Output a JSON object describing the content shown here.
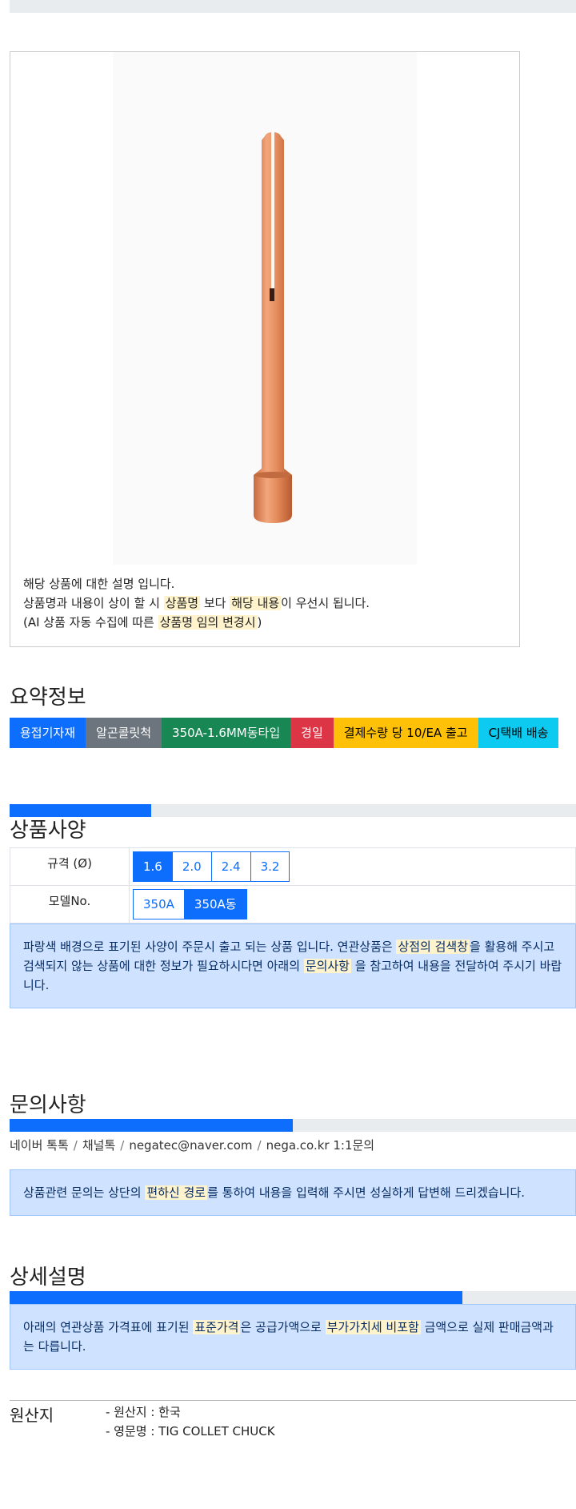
{
  "product": {
    "image_alt": "TIG collet chuck product image",
    "notes": {
      "line1": "해당 상품에 대한 설명 입니다.",
      "line2_a": "상품명과 내용이 상이 할 시 ",
      "line2_hl1": "상품명",
      "line2_b": " 보다 ",
      "line2_hl2": "해당 내용",
      "line2_c": "이 우선시 됩니다.",
      "line3_a": "(AI 상품 자동 수집에 따른 ",
      "line3_hl": "상품명 임의 변경시",
      "line3_b": ")"
    }
  },
  "summary": {
    "title": "요약정보",
    "tags": [
      {
        "label": "용접기자재",
        "color": "#0d6efd",
        "text_color": "#ffffff"
      },
      {
        "label": "알곤콜릿척",
        "color": "#6c757d",
        "text_color": "#ffffff"
      },
      {
        "label": "350A-1.6MM동타입",
        "color": "#198754",
        "text_color": "#ffffff"
      },
      {
        "label": "경일",
        "color": "#dc3545",
        "text_color": "#ffffff"
      },
      {
        "label": "결제수량 당 10/EA 출고",
        "color": "#ffc107",
        "text_color": "#000000"
      },
      {
        "label": "CJ택배 배송",
        "color": "#0dcaf0",
        "text_color": "#000000"
      }
    ]
  },
  "spec": {
    "title": "상품사양",
    "progress_fraction": 0.25,
    "rows": [
      {
        "label": "규격 (Ø)",
        "options": [
          "1.6",
          "2.0",
          "2.4",
          "3.2"
        ],
        "selected": 0
      },
      {
        "label": "모델No.",
        "options": [
          "350A",
          "350A동"
        ],
        "selected": 1
      }
    ],
    "notice": {
      "a": "파랑색 배경으로 표기된 사양이 주문시 출고 되는 상품 입니다. 연관상품은 ",
      "hl1": "상점의 검색창",
      "b": "을 활용해 주시고 검색되지 않는 상품에 대한 정보가 필요하시다면 아래의 ",
      "hl2": "문의사항",
      "c": " 을 참고하여 내용을 전달하여 주시기 바랍니다."
    }
  },
  "inquiry": {
    "title": "문의사항",
    "progress_fraction": 0.5,
    "contacts": [
      "네이버 톡톡",
      "채널톡",
      "negatec@naver.com",
      "nega.co.kr 1:1문의"
    ],
    "separator": "/",
    "notice": {
      "a": "상품관련 문의는 상단의 ",
      "hl": "편하신 경로",
      "b": "를 통하여 내용을 입력해 주시면 성실하게 답변해 드리겠습니다."
    }
  },
  "detail": {
    "title": "상세설명",
    "progress_fraction": 0.8,
    "notice": {
      "a": "아래의 연관상품 가격표에 표기된 ",
      "hl1": "표준가격",
      "b": "은 공급가액으로 ",
      "hl2": "부가가치세 비포함",
      "c": " 금액으로 실제 판매금액과는 다릅니다."
    },
    "origin_label": "원산지",
    "origin_lines": [
      "- 원산지 : 한국",
      "- 영문명 : TIG COLLET CHUCK"
    ]
  },
  "colors": {
    "accent": "#0d6efd",
    "copper": "#e8946a"
  }
}
